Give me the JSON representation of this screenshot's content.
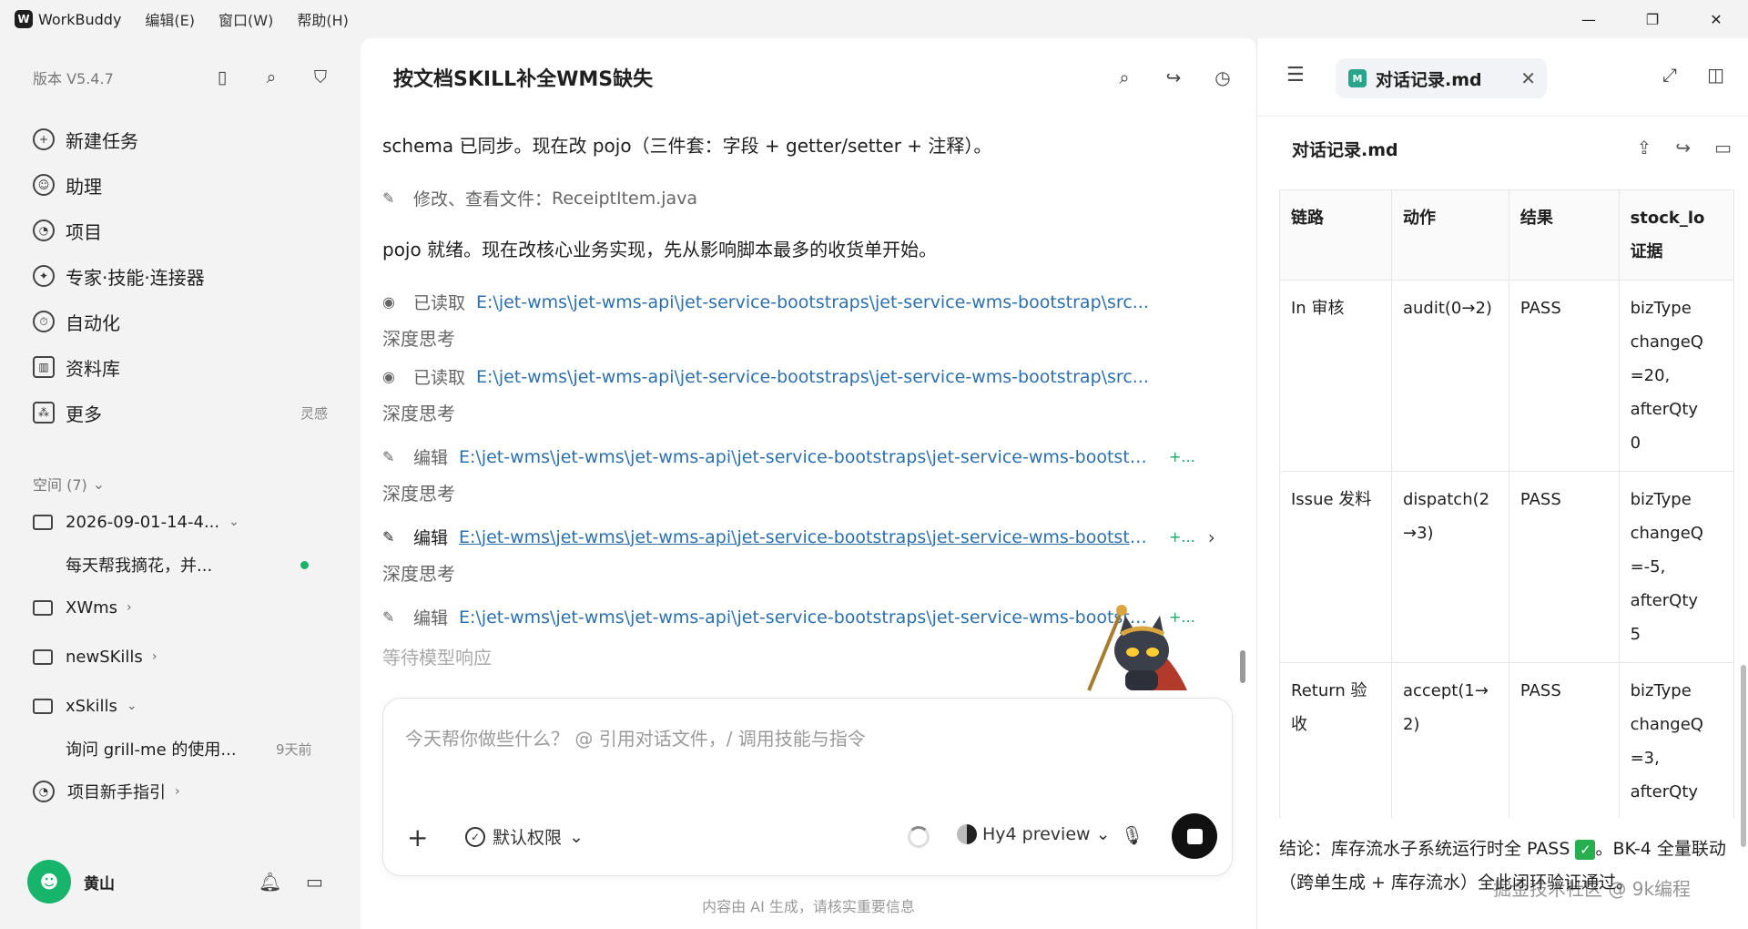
{
  "titlebar": {
    "app_name": "WorkBuddy",
    "menus": [
      "编辑(E)",
      "窗口(W)",
      "帮助(H)"
    ],
    "minimize": "—",
    "maximize": "❐",
    "close": "✕"
  },
  "sidebar": {
    "version": "版本 V5.4.7",
    "nav": [
      {
        "label": "新建任务",
        "icon": "new-task-icon"
      },
      {
        "label": "助理",
        "icon": "assistant-icon"
      },
      {
        "label": "项目",
        "icon": "project-icon"
      },
      {
        "label": "专家·技能·连接器",
        "icon": "expert-icon"
      },
      {
        "label": "自动化",
        "icon": "automation-icon"
      },
      {
        "label": "资料库",
        "icon": "library-icon"
      },
      {
        "label": "更多",
        "icon": "more-icon",
        "extra": "灵感"
      }
    ],
    "space_header": "空间 (7)",
    "folder1": {
      "label": "2026-09-01-14-4...",
      "sub": "每天帮我摘花，并..."
    },
    "folder2": "XWms",
    "folder3": "newSKills",
    "folder4": "xSkills",
    "folder4_sub": {
      "label": "询问 grill-me 的使用...",
      "meta": "9天前"
    },
    "guide": "项目新手指引",
    "user_name": "黄山"
  },
  "chat": {
    "title": "按文档SKILL补全WMS缺失",
    "msg1": "schema 已同步。现在改 pojo（三件套：字段 + getter/setter + 注释）。",
    "op1": {
      "verb": "修改、查看文件：",
      "path": "ReceiptItem.java"
    },
    "msg2": "pojo 就绪。现在改核心业务实现，先从影响脚本最多的收货单开始。",
    "read1": {
      "verb": "已读取",
      "path": "E:\\jet-wms\\jet-wms-api\\jet-service-bootstraps\\jet-service-wms-bootstrap\\src..."
    },
    "think": "深度思考",
    "read2": {
      "verb": "已读取",
      "path": "E:\\jet-wms\\jet-wms-api\\jet-service-bootstraps\\jet-service-wms-bootstrap\\src..."
    },
    "edit_verb": "编辑",
    "edit_path": "E:\\jet-wms\\jet-wms\\jet-wms-api\\jet-service-bootstraps\\jet-service-wms-bootstra...",
    "edit_plus": "+...",
    "waiting": "等待模型响应",
    "composer_placeholder": "今天帮你做些什么？ @ 引用对话文件，/ 调用技能与指令",
    "permission": "默认权限",
    "model": "Hy4 preview",
    "disclaimer": "内容由 AI 生成，请核实重要信息"
  },
  "doc": {
    "tab_label": "对话记录.md",
    "title": "对话记录.md",
    "table": {
      "headers": [
        "链路",
        "动作",
        "结果",
        "stock_lo\n证据"
      ],
      "rows": [
        [
          "In 审核",
          "audit(0→2)",
          "PASS",
          "bizType\nchangeQ\n=20,\nafterQty\n0"
        ],
        [
          "Issue 发料",
          "dispatch(2\n→3)",
          "PASS",
          "bizType\nchangeQ\n=-5,\nafterQty\n5"
        ],
        [
          "Return 验\n收",
          "accept(1→\n2)",
          "PASS",
          "bizType\nchangeQ\n=3,\nafterQty"
        ]
      ]
    },
    "conclusion_pre": "结论：库存流水子系统运行时全 PASS ",
    "conclusion_post": "。BK-4 全量联动（跨单生成 + 库存流水）全此闭环验证通过。"
  },
  "watermark": "掘金技术社区 @ 9k编程"
}
